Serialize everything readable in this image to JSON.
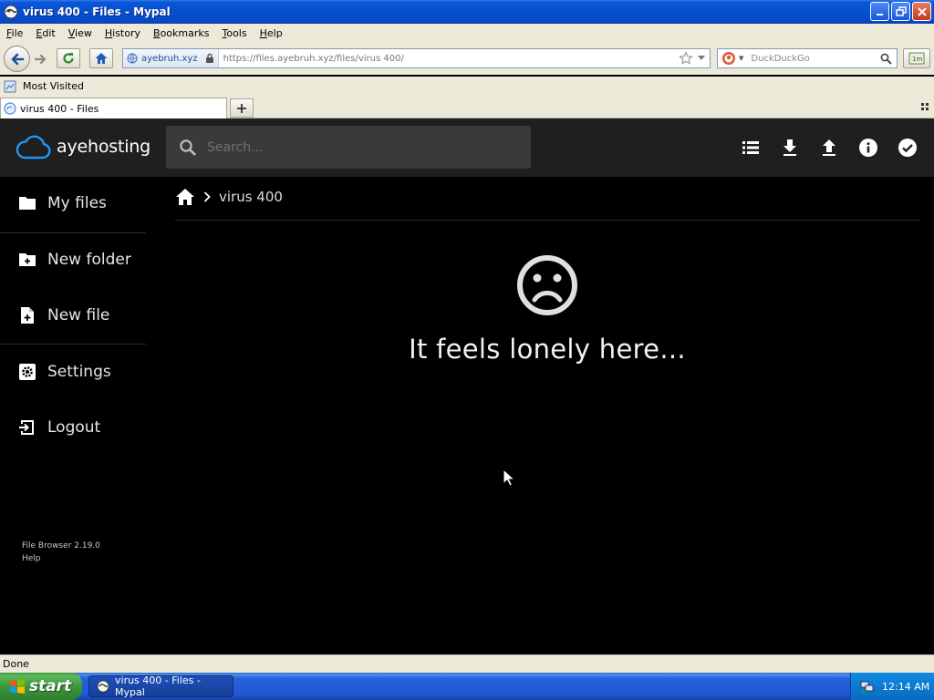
{
  "window": {
    "title": "virus 400 - Files - Mypal"
  },
  "menu": [
    "File",
    "Edit",
    "View",
    "History",
    "Bookmarks",
    "Tools",
    "Help"
  ],
  "urlbar": {
    "identity": "ayebruh.xyz",
    "url": "https://files.ayebruh.xyz/files/virus 400/"
  },
  "search": {
    "engine_placeholder": "DuckDuckGo"
  },
  "bookmarks": {
    "label": "Most Visited"
  },
  "tab": {
    "label": "virus 400 - Files"
  },
  "app": {
    "brand": "ayehosting",
    "search_placeholder": "Search...",
    "sidebar": {
      "my_files": "My files",
      "new_folder": "New folder",
      "new_file": "New file",
      "settings": "Settings",
      "logout": "Logout"
    },
    "credits": {
      "version": "File Browser 2.19.0",
      "help": "Help"
    },
    "breadcrumb": {
      "folder": "virus 400"
    },
    "empty_message": "It feels lonely here..."
  },
  "status": {
    "text": "Done"
  },
  "taskbar": {
    "start": "start",
    "item": "virus 400 - Files - Mypal",
    "clock": "12:14 AM"
  },
  "colors": {
    "app_bg": "#000000",
    "header_bg": "#1f1f1f",
    "brand_blue": "#2196f3",
    "xp_blue": "#0550d0"
  }
}
